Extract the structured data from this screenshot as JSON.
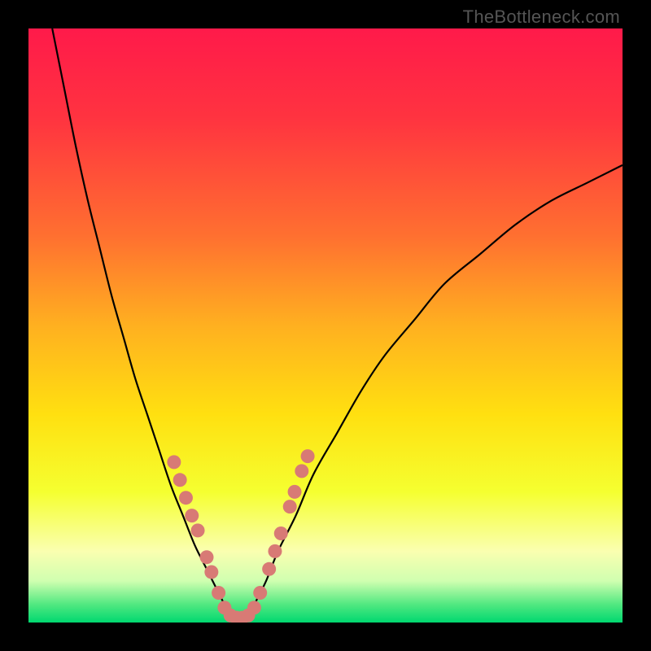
{
  "watermark": "TheBottleneck.com",
  "chart_data": {
    "type": "line",
    "title": "",
    "xlabel": "",
    "ylabel": "",
    "xlim": [
      0,
      100
    ],
    "ylim": [
      0,
      100
    ],
    "series": [
      {
        "name": "left-curve",
        "x": [
          4,
          6,
          8,
          10,
          12,
          14,
          16,
          18,
          20,
          22,
          24,
          26,
          28,
          30,
          32,
          33,
          34
        ],
        "values": [
          100,
          90,
          80,
          71,
          63,
          55,
          48,
          41,
          35,
          29,
          23,
          18,
          13,
          9,
          5,
          3,
          1
        ]
      },
      {
        "name": "right-curve",
        "x": [
          37,
          38,
          40,
          42,
          45,
          48,
          52,
          56,
          60,
          65,
          70,
          76,
          82,
          88,
          94,
          100
        ],
        "values": [
          1,
          3,
          7,
          12,
          18,
          25,
          32,
          39,
          45,
          51,
          57,
          62,
          67,
          71,
          74,
          77
        ]
      }
    ],
    "markers": [
      {
        "x": 24.5,
        "y": 27
      },
      {
        "x": 25.5,
        "y": 24
      },
      {
        "x": 26.5,
        "y": 21
      },
      {
        "x": 27.5,
        "y": 18
      },
      {
        "x": 28.5,
        "y": 15.5
      },
      {
        "x": 30,
        "y": 11
      },
      {
        "x": 30.8,
        "y": 8.5
      },
      {
        "x": 32,
        "y": 5
      },
      {
        "x": 33,
        "y": 2.5
      },
      {
        "x": 34,
        "y": 1.2
      },
      {
        "x": 35,
        "y": 0.8
      },
      {
        "x": 36,
        "y": 0.8
      },
      {
        "x": 37,
        "y": 1.2
      },
      {
        "x": 38,
        "y": 2.5
      },
      {
        "x": 39,
        "y": 5
      },
      {
        "x": 40.5,
        "y": 9
      },
      {
        "x": 41.5,
        "y": 12
      },
      {
        "x": 42.5,
        "y": 15
      },
      {
        "x": 44,
        "y": 19.5
      },
      {
        "x": 44.8,
        "y": 22
      },
      {
        "x": 46,
        "y": 25.5
      },
      {
        "x": 47,
        "y": 28
      }
    ],
    "gradient_stops": [
      {
        "offset": 0,
        "color": "#ff1a4a"
      },
      {
        "offset": 0.15,
        "color": "#ff3340"
      },
      {
        "offset": 0.35,
        "color": "#ff7030"
      },
      {
        "offset": 0.5,
        "color": "#ffb020"
      },
      {
        "offset": 0.65,
        "color": "#ffe010"
      },
      {
        "offset": 0.78,
        "color": "#f5ff30"
      },
      {
        "offset": 0.88,
        "color": "#faffb0"
      },
      {
        "offset": 0.93,
        "color": "#d0ffb0"
      },
      {
        "offset": 0.97,
        "color": "#50e880"
      },
      {
        "offset": 1.0,
        "color": "#00d870"
      }
    ],
    "marker_color": "#d87a75",
    "curve_color": "#000000"
  }
}
